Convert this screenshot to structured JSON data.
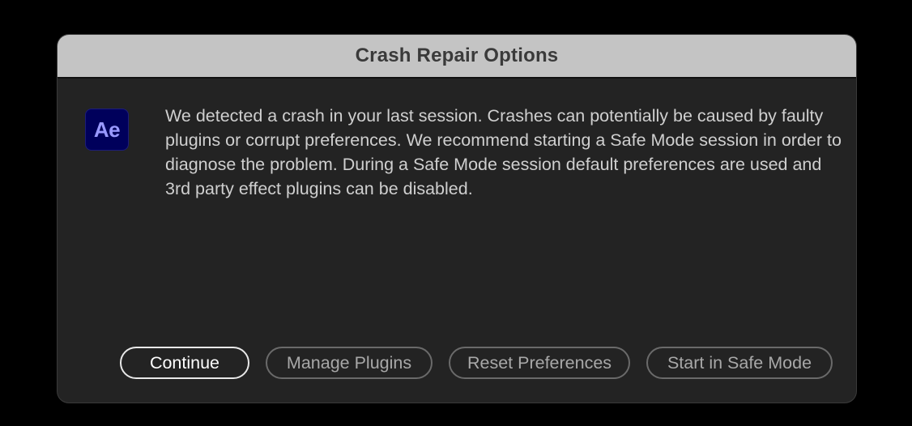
{
  "dialog": {
    "title": "Crash Repair Options",
    "app_icon_label": "Ae",
    "message": "We detected a crash in your last session. Crashes can potentially be caused by faulty plugins or corrupt preferences. We recommend starting a Safe Mode session in order to diagnose the problem. During a Safe Mode session default preferences are used and 3rd party effect plugins can be disabled.",
    "buttons": {
      "continue": "Continue",
      "manage_plugins": "Manage Plugins",
      "reset_preferences": "Reset Preferences",
      "start_safe_mode": "Start in Safe Mode"
    }
  },
  "colors": {
    "app_icon_bg": "#00005b",
    "app_icon_text": "#9999ff",
    "dialog_bg": "#232323",
    "titlebar_bg": "#c4c4c4"
  }
}
